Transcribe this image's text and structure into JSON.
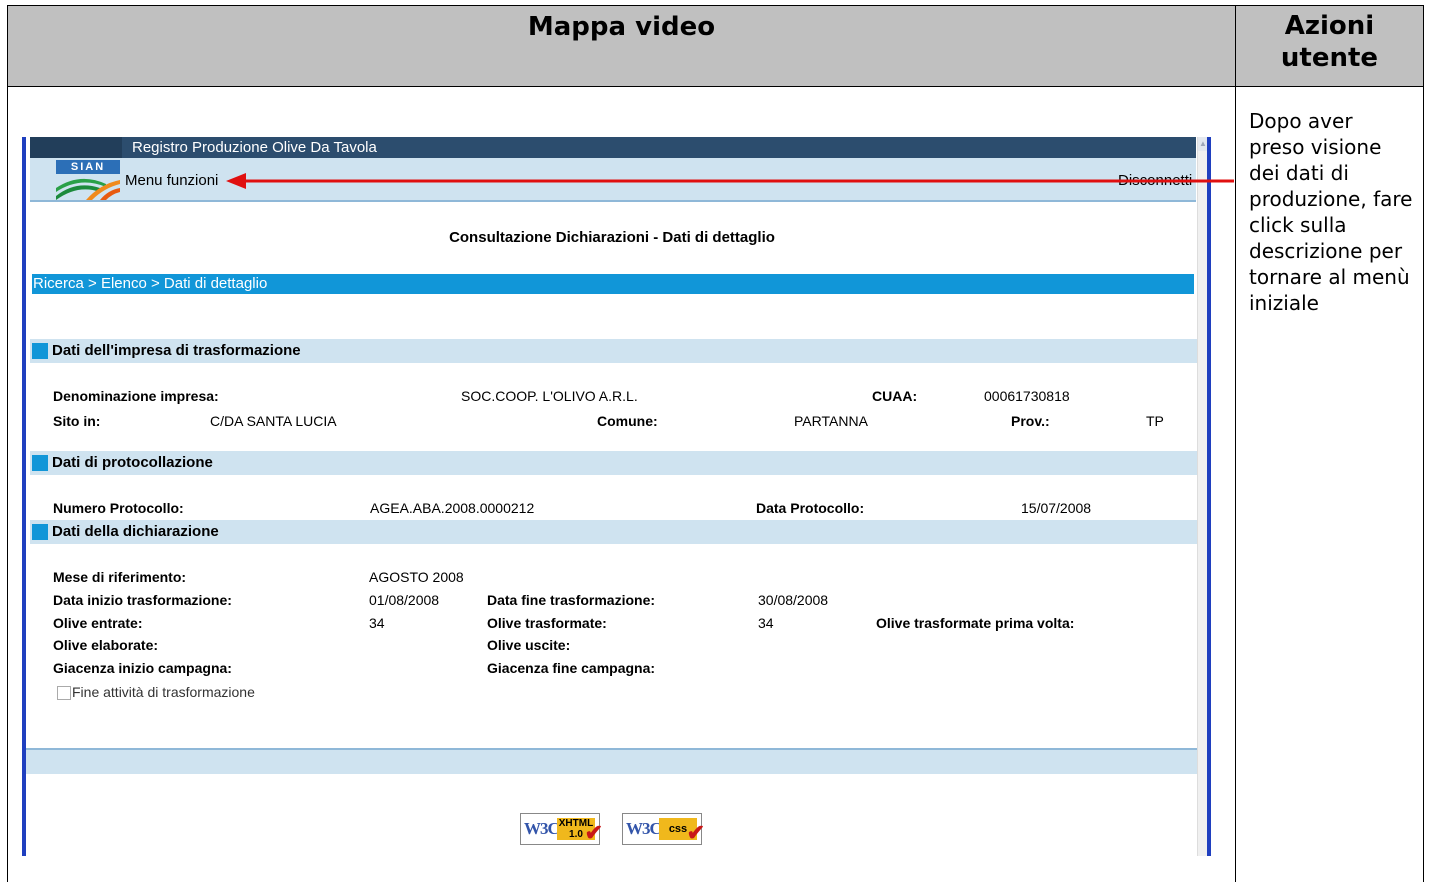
{
  "document": {
    "header_left": "Mappa video",
    "header_right": "Azioni utente",
    "user_action_note": "Dopo aver preso visione dei dati di produzione, fare click sulla descrizione per tornare al menù iniziale"
  },
  "app": {
    "title": "Registro Produzione Olive Da Tavola",
    "logo_text": "SIAN",
    "menu_link": "Menu funzioni",
    "disconnect_link": "Disconnetti",
    "page_heading": "Consultazione Dichiarazioni - Dati di dettaglio",
    "breadcrumb": "Ricerca > Elenco > Dati di dettaglio",
    "sections": {
      "impresa": {
        "title": "Dati dell'impresa di trasformazione",
        "denominazione_label": "Denominazione impresa:",
        "denominazione_value": "SOC.COOP. L'OLIVO A.R.L.",
        "cuaa_label": "CUAA:",
        "cuaa_value": "00061730818",
        "sito_label": "Sito in:",
        "sito_value": "C/DA SANTA LUCIA",
        "comune_label": "Comune:",
        "comune_value": "PARTANNA",
        "prov_label": "Prov.:",
        "prov_value": "TP"
      },
      "protocollo": {
        "title": "Dati di protocollazione",
        "numero_label": "Numero Protocollo:",
        "numero_value": "AGEA.ABA.2008.0000212",
        "data_label": "Data Protocollo:",
        "data_value": "15/07/2008"
      },
      "dichiarazione": {
        "title": "Dati della dichiarazione",
        "mese_label": "Mese di riferimento:",
        "mese_value": "AGOSTO 2008",
        "inizio_label": "Data inizio trasformazione:",
        "inizio_value": "01/08/2008",
        "fine_label": "Data fine trasformazione:",
        "fine_value": "30/08/2008",
        "entrate_label": "Olive entrate:",
        "entrate_value": "34",
        "trasformate_label": "Olive trasformate:",
        "trasformate_value": "34",
        "prima_volta_label": "Olive trasformate prima volta:",
        "elaborate_label": "Olive elaborate:",
        "uscite_label": "Olive uscite:",
        "giacenza_inizio_label": "Giacenza inizio campagna:",
        "giacenza_fine_label": "Giacenza fine campagna:",
        "fine_attivita_label": "Fine attività di trasformazione"
      }
    },
    "badges": {
      "w3c": "W3C",
      "xhtml_line1": "XHTML",
      "xhtml_line2": "1.0",
      "css": "css"
    },
    "colors": {
      "title_bar": "#2c4d6e",
      "section_bg": "#cfe3f0",
      "accent_blue": "#1196d8",
      "arrow_red": "#e01010"
    }
  }
}
